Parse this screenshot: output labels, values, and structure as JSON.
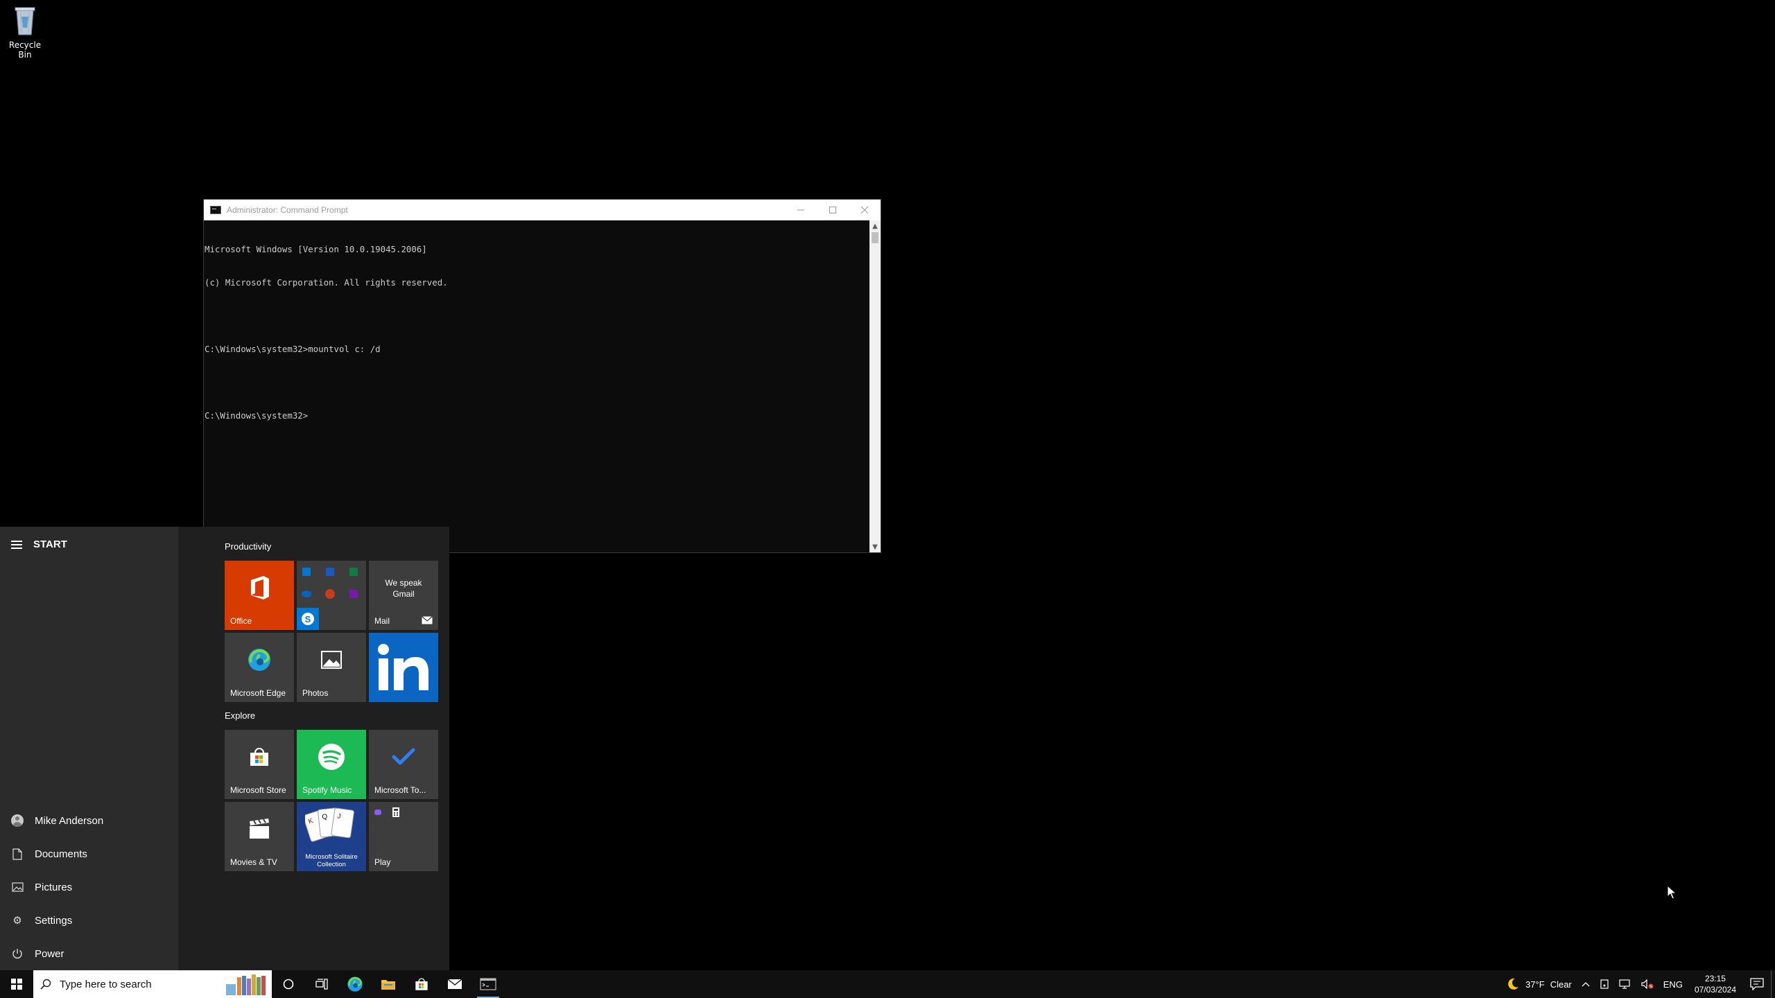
{
  "desktop": {
    "recycle_bin_label": "Recycle Bin"
  },
  "cmd": {
    "title": "Administrator: Command Prompt",
    "lines": [
      "Microsoft Windows [Version 10.0.19045.2006]",
      "(c) Microsoft Corporation. All rights reserved.",
      "",
      "C:\\Windows\\system32>mountvol c: /d",
      "",
      "C:\\Windows\\system32>"
    ],
    "min_icon": "minimize-icon",
    "max_icon": "maximize-icon",
    "close_icon": "close-icon"
  },
  "start_menu": {
    "title": "START",
    "nav": [
      {
        "label": "Mike Anderson",
        "icon": "avatar-icon"
      },
      {
        "label": "Documents",
        "icon": "document-icon"
      },
      {
        "label": "Pictures",
        "icon": "pictures-icon"
      },
      {
        "label": "Settings",
        "icon": "gear-icon"
      },
      {
        "label": "Power",
        "icon": "power-icon"
      }
    ],
    "groups": {
      "productivity": "Productivity",
      "explore": "Explore"
    },
    "tiles": {
      "office": "Office",
      "mail": "Mail",
      "mail_tagline": "We speak Gmail",
      "edge": "Microsoft Edge",
      "photos": "Photos",
      "store": "Microsoft Store",
      "spotify": "Spotify Music",
      "todo": "Microsoft To...",
      "movies": "Movies & TV",
      "solitaire": "Microsoft Solitaire Collection",
      "play": "Play"
    },
    "colors": {
      "office": "#d83b01",
      "linkedin": "#0a66c2",
      "spotify": "#1db954",
      "solitaire": "#1e3f8c"
    }
  },
  "taskbar": {
    "search_placeholder": "Type here to search",
    "weather_temp": "37°F",
    "weather_cond": "Clear",
    "lang": "ENG",
    "time": "23:15",
    "date": "07/03/2024",
    "accent": "#76b9ed"
  }
}
